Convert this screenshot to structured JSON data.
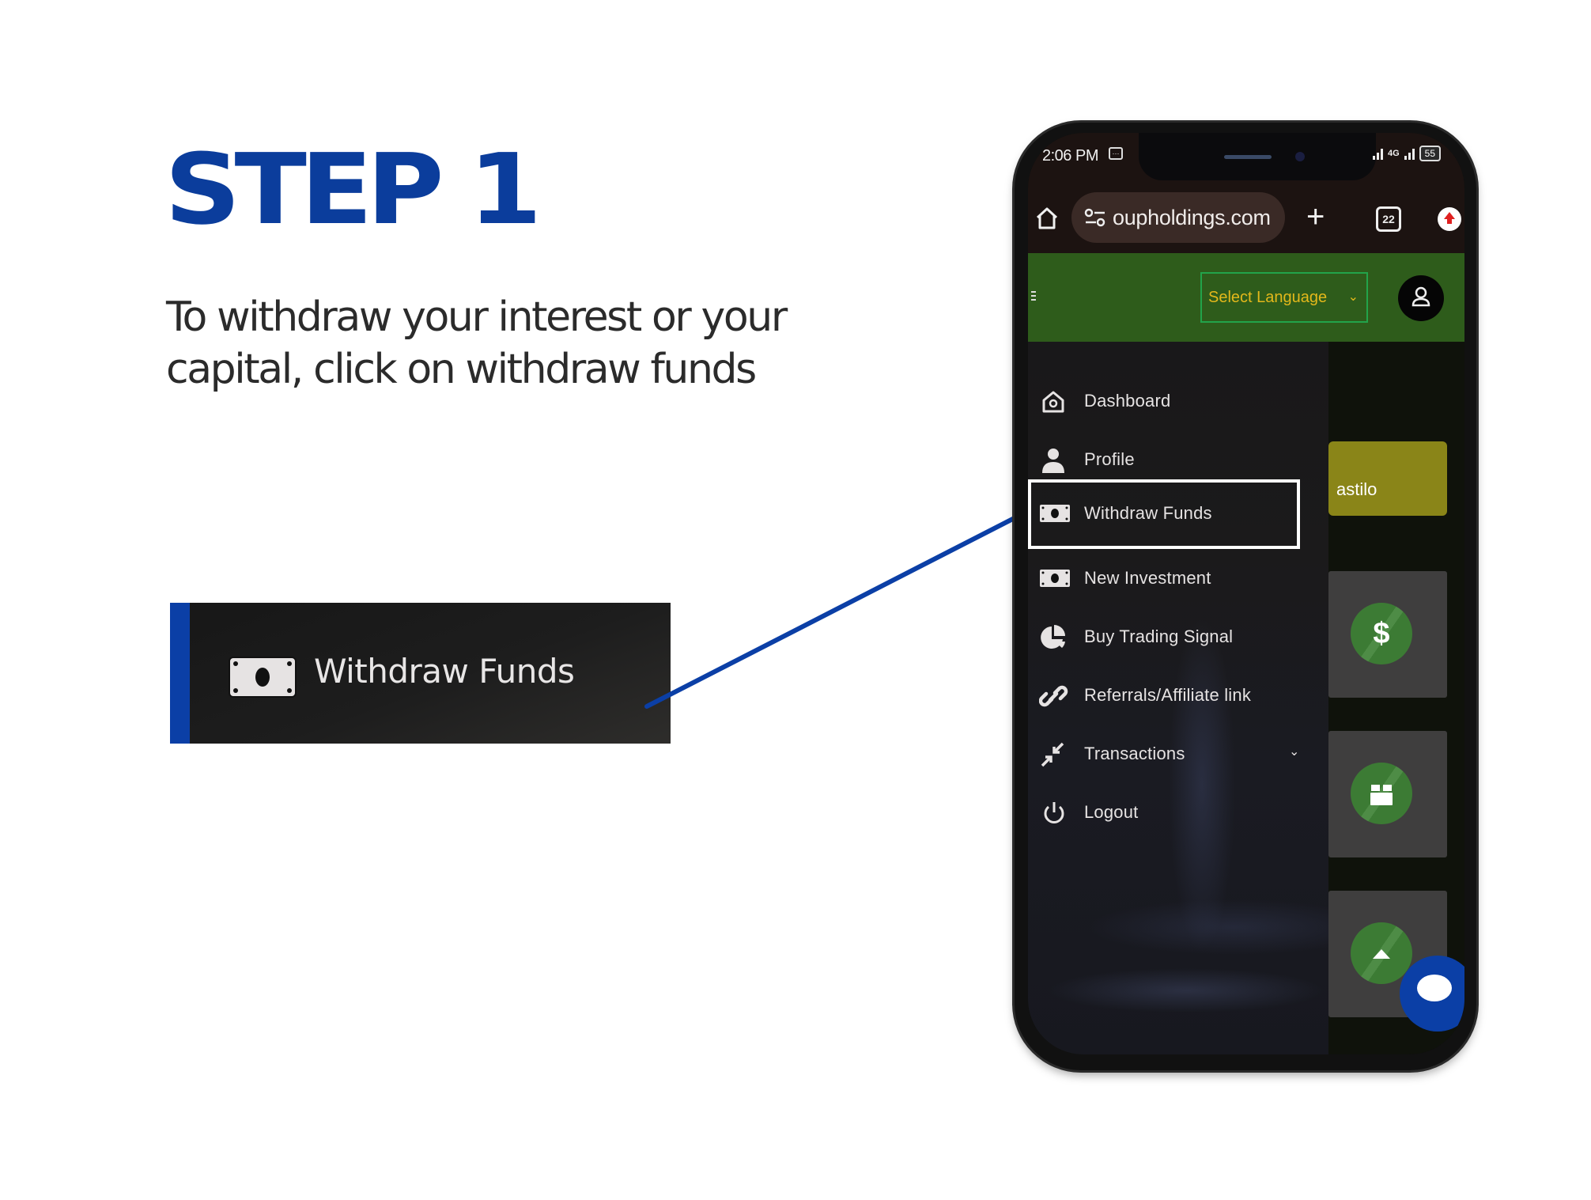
{
  "tutorial": {
    "step_title": "STEP 1",
    "instruction_line1": "To withdraw your interest or your",
    "instruction_line2": "capital, click on withdraw funds",
    "callout_label": "Withdraw Funds",
    "accent_color": "#0b3d9c"
  },
  "phone": {
    "status_bar": {
      "time": "2:06 PM",
      "network": "4G",
      "battery": "55"
    },
    "browser": {
      "url": "oupholdings.com",
      "tab_count": "22",
      "new_tab_label": "+"
    },
    "topnav": {
      "language_select": "Select Language",
      "language_chevron": "⌄"
    },
    "sidebar": {
      "items": [
        {
          "label": "Dashboard",
          "icon": "home-icon"
        },
        {
          "label": "Profile",
          "icon": "user-icon"
        },
        {
          "label": "Withdraw Funds",
          "icon": "money-icon",
          "active": true
        },
        {
          "label": "New Investment",
          "icon": "money-icon"
        },
        {
          "label": "Buy Trading Signal",
          "icon": "pie-chart-icon"
        },
        {
          "label": "Referrals/Affiliate link",
          "icon": "link-icon"
        },
        {
          "label": "Transactions",
          "icon": "compress-arrows-icon",
          "has_submenu": true,
          "chevron": "⌄"
        },
        {
          "label": "Logout",
          "icon": "power-icon"
        }
      ]
    },
    "main": {
      "name_card_text": "astilo",
      "stat_cards": [
        {
          "icon": "dollar-icon",
          "symbol": "$"
        },
        {
          "icon": "box-icon"
        },
        {
          "icon": "caret-up-icon"
        }
      ],
      "colors": {
        "topnav_green": "#2e5c1b",
        "name_card": "#8a8518",
        "circle_green": "#3c7b34",
        "chat_blue": "#0b3fa6"
      }
    }
  }
}
